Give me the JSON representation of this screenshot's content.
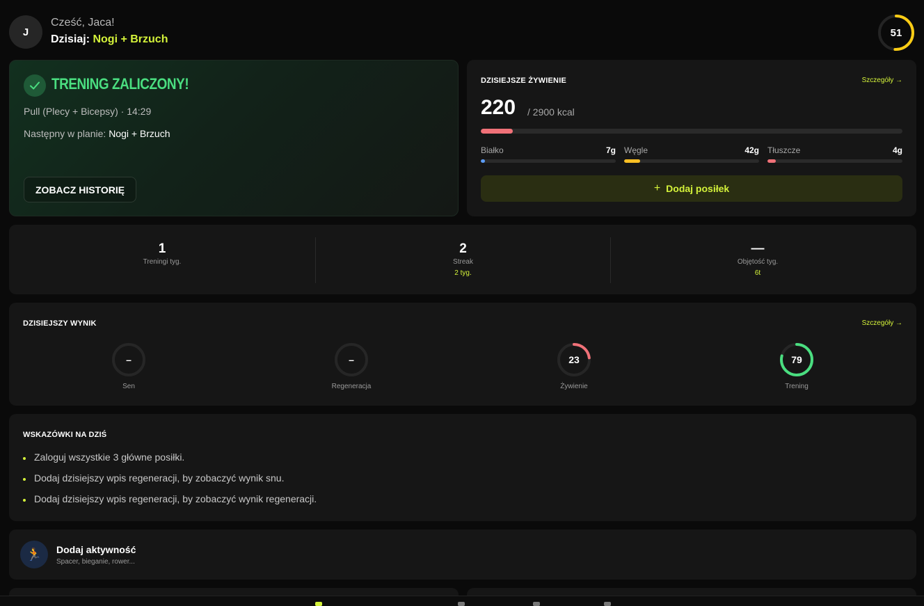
{
  "header": {
    "avatar_initial": "J",
    "greeting": "Cześć, Jaca!",
    "today_label": "Dzisiaj:",
    "today_plan": "Nogi + Brzuch",
    "score": "51",
    "score_fraction": 0.51
  },
  "training": {
    "title": "TRENING ZALICZONY!",
    "summary": "Pull (Plecy + Bicepsy) · 14:29",
    "next_label": "Następny w planie:",
    "next_plan": "Nogi + Brzuch",
    "history_button": "ZOBACZ HISTORIĘ"
  },
  "nutrition": {
    "title": "DZISIEJSZE ŻYWIENIE",
    "details_link": "Szczegóły →",
    "kcal": "220",
    "kcal_goal": "/ 2900 kcal",
    "kcal_fraction": 0.076,
    "macros": [
      {
        "label": "Białko",
        "value": "7g",
        "fraction": 0.03,
        "color": "#5b9cf5"
      },
      {
        "label": "Węgle",
        "value": "42g",
        "fraction": 0.12,
        "color": "#fbbf24"
      },
      {
        "label": "Tłuszcze",
        "value": "4g",
        "fraction": 0.06,
        "color": "#f07178"
      }
    ],
    "add_meal_button": "Dodaj posiłek"
  },
  "stats": [
    {
      "value": "1",
      "label": "Treningi tyg.",
      "sub": ""
    },
    {
      "value": "2",
      "label": "Streak",
      "sub": "2 tyg."
    },
    {
      "value": "—",
      "label": "Objętość tyg.",
      "sub": "6t"
    }
  ],
  "daily_score": {
    "title": "DZISIEJSZY WYNIK",
    "details_link": "Szczegóły →",
    "items": [
      {
        "label": "Sen",
        "value": "–",
        "fraction": 0,
        "color": "#555555"
      },
      {
        "label": "Regeneracja",
        "value": "–",
        "fraction": 0,
        "color": "#555555"
      },
      {
        "label": "Żywienie",
        "value": "23",
        "fraction": 0.23,
        "color": "#f07178"
      },
      {
        "label": "Trening",
        "value": "79",
        "fraction": 0.79,
        "color": "#4ade80"
      }
    ]
  },
  "tips": {
    "title": "WSKAZÓWKI NA DZIŚ",
    "items": [
      "Zaloguj wszystkie 3 główne posiłki.",
      "Dodaj dzisiejszy wpis regeneracji, by zobaczyć wynik snu.",
      "Dodaj dzisiejszy wpis regeneracji, by zobaczyć wynik regeneracji."
    ]
  },
  "activity": {
    "icon": "🏃",
    "title": "Dodaj aktywność",
    "subtitle": "Spacer, bieganie, rower..."
  },
  "colors": {
    "accent": "#d4f23a",
    "success": "#4ade80",
    "card": "#161616",
    "background": "#0a0a0a"
  }
}
